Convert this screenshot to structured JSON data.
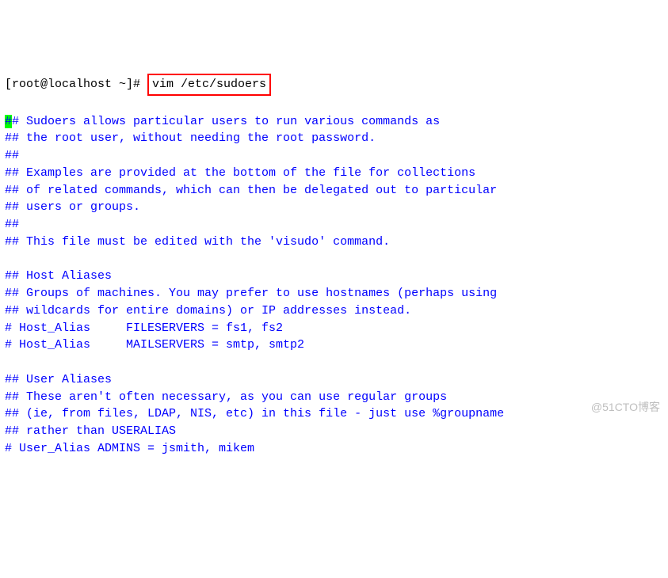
{
  "prompt": {
    "shell_prompt": "[root@localhost ~]# ",
    "command": "vim /etc/sudoers"
  },
  "lines": {
    "l1_cursor": "#",
    "l1_rest": "# Sudoers allows particular users to run various commands as",
    "l2": "## the root user, without needing the root password.",
    "l3": "##",
    "l4": "## Examples are provided at the bottom of the file for collections",
    "l5": "## of related commands, which can then be delegated out to particular",
    "l6": "## users or groups.",
    "l7": "##",
    "l8": "## This file must be edited with the 'visudo' command.",
    "l9": "",
    "l10": "## Host Aliases",
    "l11": "## Groups of machines. You may prefer to use hostnames (perhaps using",
    "l12": "## wildcards for entire domains) or IP addresses instead.",
    "l13": "# Host_Alias     FILESERVERS = fs1, fs2",
    "l14": "# Host_Alias     MAILSERVERS = smtp, smtp2",
    "l15": "",
    "l16": "## User Aliases",
    "l17": "## These aren't often necessary, as you can use regular groups",
    "l18": "## (ie, from files, LDAP, NIS, etc) in this file - just use %groupname",
    "l19": "## rather than USERALIAS",
    "l20": "# User_Alias ADMINS = jsmith, mikem"
  },
  "watermark": "@51CTO博客"
}
